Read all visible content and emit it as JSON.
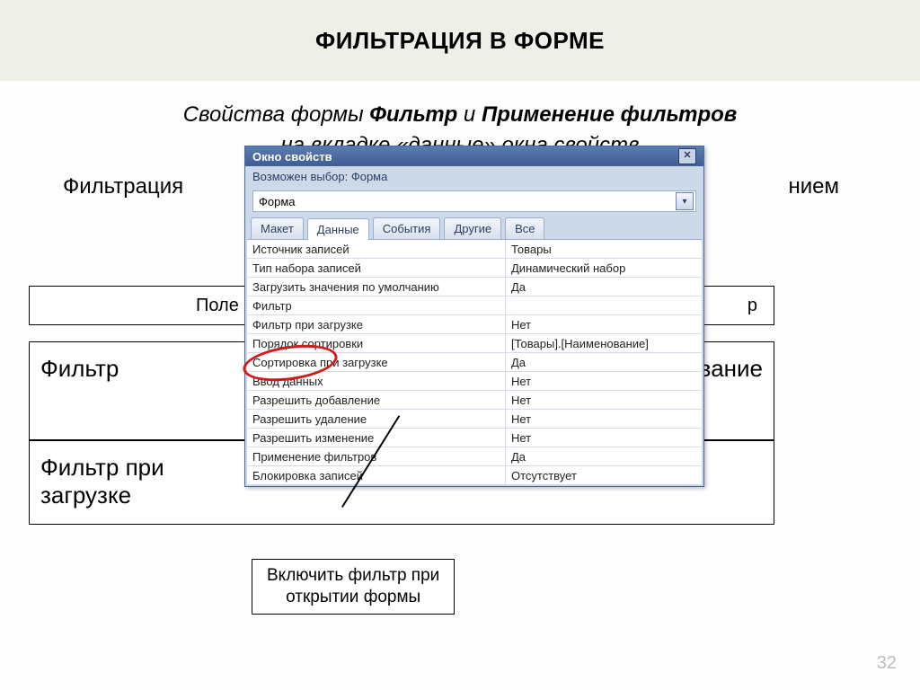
{
  "slide": {
    "title": "ФИЛЬТРАЦИЯ В ФОРМЕ",
    "line1_pre": "Свойства формы ",
    "line1_b1": "Фильтр",
    "line1_mid": " и ",
    "line1_b2": "Применение фильтров",
    "line2": "на вкладке «данные» окна свойств",
    "line3_pre": "Фильтрация",
    "line3_post": "нием",
    "page_num": "32"
  },
  "bg_table": {
    "header_left": "Поле",
    "header_right": "р",
    "row1_label": "Фильтр",
    "row1_right": "вание",
    "row2_label": "Фильтр при загрузке"
  },
  "props_window": {
    "title": "Окно свойств",
    "subtitle": "Возможен выбор: Форма",
    "combo_value": "Форма",
    "tabs": [
      "Макет",
      "Данные",
      "События",
      "Другие",
      "Все"
    ],
    "active_tab_index": 1,
    "rows": [
      {
        "key": "Источник записей",
        "val": "Товары"
      },
      {
        "key": "Тип набора записей",
        "val": "Динамический набор"
      },
      {
        "key": "Загрузить значения по умолчанию",
        "val": "Да"
      },
      {
        "key": "Фильтр",
        "val": ""
      },
      {
        "key": "Фильтр при загрузке",
        "val": "Нет"
      },
      {
        "key": "Порядок сортировки",
        "val": "[Товары].[Наименование]"
      },
      {
        "key": "Сортировка при загрузке",
        "val": "Да"
      },
      {
        "key": "Ввод данных",
        "val": "Нет"
      },
      {
        "key": "Разрешить добавление",
        "val": "Нет"
      },
      {
        "key": "Разрешить удаление",
        "val": "Нет"
      },
      {
        "key": "Разрешить изменение",
        "val": "Нет"
      },
      {
        "key": "Применение фильтров",
        "val": "Да"
      },
      {
        "key": "Блокировка записей",
        "val": "Отсутствует"
      }
    ]
  },
  "callout": {
    "text_line1": "Включить фильтр при",
    "text_line2": "открытии формы"
  }
}
